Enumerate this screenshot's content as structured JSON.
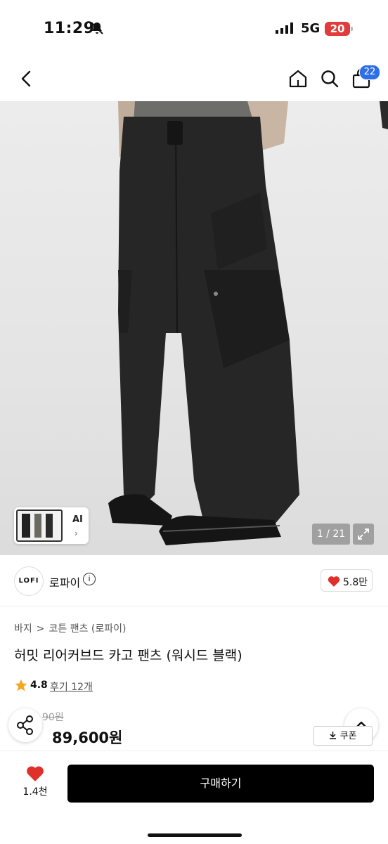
{
  "status": {
    "time": "11:29",
    "network": "5G",
    "battery": "20"
  },
  "nav": {
    "cart_count": "22"
  },
  "gallery": {
    "counter": "1 / 21",
    "thumb_label": "AI",
    "thumb_chevron": "›"
  },
  "brand": {
    "logo": "LOFI",
    "name": "로파이",
    "info_glyph": "i",
    "likes": "5.8만"
  },
  "breadcrumb": [
    "바지",
    ">",
    "코튼 팬츠 (로파이)"
  ],
  "product": {
    "title": "허밋 리어커브드 카고 팬츠 (워시드 블랙)",
    "rating": "4.8",
    "reviews": "후기 12개",
    "original_price": "90원",
    "discount": "%",
    "price": "89,600원"
  },
  "coupon": {
    "label": "쿠폰"
  },
  "bottom": {
    "likes": "1.4천",
    "buy_label": "구매하기"
  },
  "colors": {
    "accent_red": "#e0302a",
    "badge_blue": "#2f6fe4",
    "buy_bg": "#000000"
  }
}
